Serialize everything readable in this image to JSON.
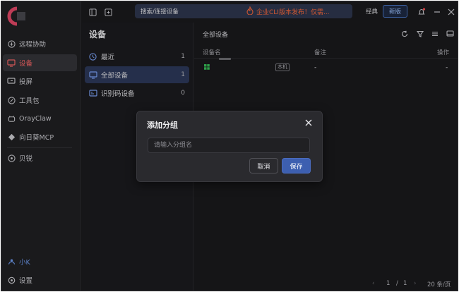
{
  "topbar": {
    "search_placeholder": "搜索/连接设备",
    "promo_text": "企业CLI版本发布！仅需...",
    "mode_classic": "经典",
    "mode_new": "新版"
  },
  "nav": {
    "items": [
      {
        "label": "远程协助",
        "icon": "remote-assist-icon"
      },
      {
        "label": "设备",
        "icon": "monitor-icon"
      },
      {
        "label": "投屏",
        "icon": "screen-cast-icon"
      },
      {
        "label": "工具包",
        "icon": "toolkit-icon"
      },
      {
        "label": "OrayClaw",
        "icon": "claw-icon"
      },
      {
        "label": "向日葵MCP",
        "icon": "mcp-icon"
      },
      {
        "label": "贝锐",
        "icon": "oray-icon"
      }
    ],
    "user": "小K",
    "settings": "设置"
  },
  "groups": {
    "title": "设备",
    "items": [
      {
        "label": "最近",
        "count": "1"
      },
      {
        "label": "全部设备",
        "count": "1"
      },
      {
        "label": "识别码设备",
        "count": "0"
      }
    ]
  },
  "main": {
    "title": "全部设备",
    "headers": {
      "name": "设备名",
      "note": "备注",
      "action": "操作"
    },
    "row": {
      "tag": "本机",
      "note": "-",
      "action": "-"
    },
    "pager": {
      "page": "1",
      "sep": "/",
      "total": "1",
      "per_page": "20 条/页"
    }
  },
  "dialog": {
    "title": "添加分组",
    "placeholder": "请输入分组名",
    "cancel": "取消",
    "save": "保存"
  },
  "colors": {
    "accent": "#ff6a6a",
    "primary": "#3d5fb0",
    "promo": "#ff6b3d"
  }
}
